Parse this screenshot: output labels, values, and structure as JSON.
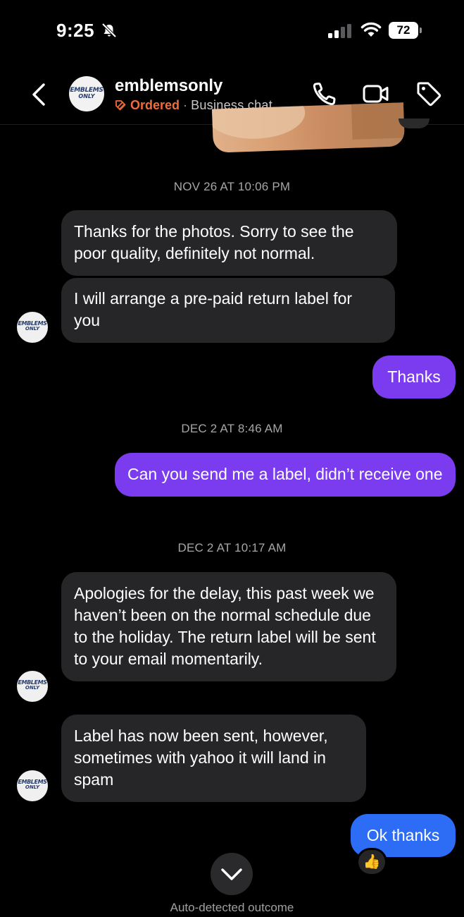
{
  "status_bar": {
    "time": "9:25",
    "battery": "72",
    "silent_icon": "bell-slash-icon"
  },
  "header": {
    "back_icon": "chevron-left-icon",
    "avatar_logo": {
      "line1": "EMBLEMS",
      "line2": "ONLY"
    },
    "name": "emblemsonly",
    "order_status": "Ordered",
    "separator": "·",
    "chat_type": "Business chat",
    "actions": [
      "phone-icon",
      "video-camera-icon",
      "tag-icon"
    ]
  },
  "colors": {
    "background": "#000000",
    "incoming_bubble": "#262628",
    "outgoing_bubble": "#7b3cf0",
    "outgoing_last": "#2d6df6",
    "ordered": "#f26b3a"
  },
  "messages": {
    "ts1": "NOV 26 AT 10:06 PM",
    "m1": "Thanks for the photos. Sorry to see the poor quality, definitely not normal.",
    "m2": "I will arrange a pre-paid return label for you",
    "m3": "Thanks",
    "ts2": "DEC 2 AT 8:46 AM",
    "m4": "Can you send me a label,  didn’t receive one",
    "ts3": "DEC 2 AT 10:17 AM",
    "m5": "Apologies for the delay, this past week we haven’t been on the normal schedule due to the holiday. The return label will be sent to your email momentarily.",
    "m6": "Label has now been sent, however, sometimes with yahoo it will land in spam",
    "m7": "Ok thanks",
    "reaction": "👍"
  },
  "footer": {
    "scroll_icon": "chevron-down-icon",
    "label": "Auto-detected outcome"
  }
}
